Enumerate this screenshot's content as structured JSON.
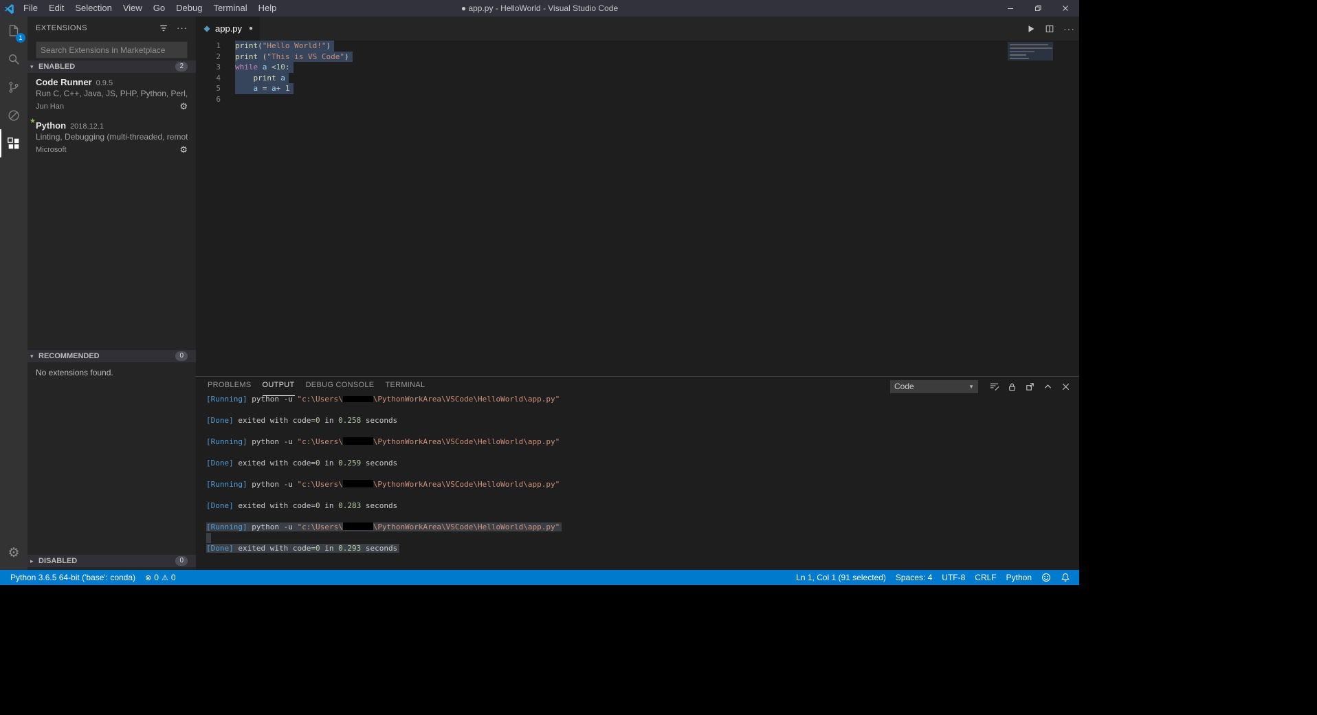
{
  "window": {
    "title": "● app.py - HelloWorld - Visual Studio Code",
    "menu_items": [
      "File",
      "Edit",
      "Selection",
      "View",
      "Go",
      "Debug",
      "Terminal",
      "Help"
    ]
  },
  "icons": {
    "gear": "⚙",
    "star": "★",
    "twisty_expanded": "▾",
    "twisty_collapsed": "▸",
    "ellipsis": "···",
    "dropdown_arrow": "▼",
    "error": "⊗",
    "warning": "⚠",
    "modified_dot": "●"
  },
  "activity_bar": {
    "explorer_badge": "1"
  },
  "sidebar": {
    "title": "EXTENSIONS",
    "search_placeholder": "Search Extensions in Marketplace",
    "sections": {
      "enabled": {
        "label": "ENABLED",
        "count": "2"
      },
      "recommended": {
        "label": "RECOMMENDED",
        "count": "0",
        "empty_message": "No extensions found."
      },
      "disabled": {
        "label": "DISABLED",
        "count": "0"
      }
    },
    "extensions": [
      {
        "name": "Code Runner",
        "version": "0.9.5",
        "description": "Run C, C++, Java, JS, PHP, Python, Perl, Ruby, ...",
        "author": "Jun Han",
        "starred": false
      },
      {
        "name": "Python",
        "version": "2018.12.1",
        "description": "Linting, Debugging (multi-threaded, remote), ...",
        "author": "Microsoft",
        "starred": true
      }
    ]
  },
  "editor": {
    "tab_label": "app.py",
    "lines": [
      {
        "num": "1",
        "selected": true,
        "tokens": [
          [
            "print",
            "func"
          ],
          [
            "(",
            "plain"
          ],
          [
            "\"Hello World!\"",
            "string"
          ],
          [
            ")",
            "plain"
          ]
        ]
      },
      {
        "num": "2",
        "selected": true,
        "tokens": [
          [
            "print",
            "func"
          ],
          [
            " (",
            "plain"
          ],
          [
            "\"This is VS Code\"",
            "string"
          ],
          [
            ")",
            "plain"
          ]
        ]
      },
      {
        "num": "3",
        "selected": true,
        "tokens": [
          [
            "while",
            "kw"
          ],
          [
            " ",
            "plain"
          ],
          [
            "a",
            "var"
          ],
          [
            " <",
            "plain"
          ],
          [
            "10",
            "number"
          ],
          [
            ":",
            "plain"
          ]
        ]
      },
      {
        "num": "4",
        "selected": true,
        "tokens": [
          [
            "    ",
            "plain"
          ],
          [
            "print",
            "func"
          ],
          [
            " ",
            "plain"
          ],
          [
            "a",
            "var"
          ]
        ]
      },
      {
        "num": "5",
        "selected": true,
        "tokens": [
          [
            "    ",
            "plain"
          ],
          [
            "a",
            "var"
          ],
          [
            " = ",
            "plain"
          ],
          [
            "a",
            "var"
          ],
          [
            "+ ",
            "plain"
          ],
          [
            "1",
            "number"
          ]
        ]
      },
      {
        "num": "6",
        "selected": false,
        "tokens": []
      }
    ]
  },
  "panel": {
    "tabs": [
      {
        "label": "PROBLEMS",
        "active": false
      },
      {
        "label": "OUTPUT",
        "active": true
      },
      {
        "label": "DEBUG CONSOLE",
        "active": false
      },
      {
        "label": "TERMINAL",
        "active": false
      }
    ],
    "channel": "Code",
    "output": [
      {
        "blank": true
      },
      {
        "selected": false,
        "tokens": [
          [
            "[Running] ",
            "tag"
          ],
          [
            "python -u ",
            "plain"
          ],
          [
            "\"c:\\Users\\",
            "string"
          ],
          [
            "",
            "redact"
          ],
          [
            "\\PythonWorkArea\\VSCode\\HelloWorld\\app.py\"",
            "string"
          ]
        ]
      },
      {
        "blank": true
      },
      {
        "selected": false,
        "tokens": [
          [
            "[Done] ",
            "tag"
          ],
          [
            "exited with code=",
            "plain"
          ],
          [
            "0",
            "number"
          ],
          [
            " in ",
            "plain"
          ],
          [
            "0.258",
            "number"
          ],
          [
            " seconds",
            "plain"
          ]
        ]
      },
      {
        "blank": true
      },
      {
        "selected": false,
        "tokens": [
          [
            "[Running] ",
            "tag"
          ],
          [
            "python -u ",
            "plain"
          ],
          [
            "\"c:\\Users\\",
            "string"
          ],
          [
            "",
            "redact"
          ],
          [
            "\\PythonWorkArea\\VSCode\\HelloWorld\\app.py\"",
            "string"
          ]
        ]
      },
      {
        "blank": true
      },
      {
        "selected": false,
        "tokens": [
          [
            "[Done] ",
            "tag"
          ],
          [
            "exited with code=",
            "plain"
          ],
          [
            "0",
            "number"
          ],
          [
            " in ",
            "plain"
          ],
          [
            "0.259",
            "number"
          ],
          [
            " seconds",
            "plain"
          ]
        ]
      },
      {
        "blank": true
      },
      {
        "selected": false,
        "tokens": [
          [
            "[Running] ",
            "tag"
          ],
          [
            "python -u ",
            "plain"
          ],
          [
            "\"c:\\Users\\",
            "string"
          ],
          [
            "",
            "redact"
          ],
          [
            "\\PythonWorkArea\\VSCode\\HelloWorld\\app.py\"",
            "string"
          ]
        ]
      },
      {
        "blank": true
      },
      {
        "selected": false,
        "tokens": [
          [
            "[Done] ",
            "tag"
          ],
          [
            "exited with code=",
            "plain"
          ],
          [
            "0",
            "number"
          ],
          [
            " in ",
            "plain"
          ],
          [
            "0.283",
            "number"
          ],
          [
            " seconds",
            "plain"
          ]
        ]
      },
      {
        "blank": true
      },
      {
        "selected": true,
        "tokens": [
          [
            "[Running] ",
            "tag"
          ],
          [
            "python -u ",
            "plain"
          ],
          [
            "\"c:\\Users\\",
            "string"
          ],
          [
            "",
            "redact"
          ],
          [
            "\\PythonWorkArea\\VSCode\\HelloWorld\\app.py\"",
            "string"
          ]
        ]
      },
      {
        "blank": true,
        "strip": true
      },
      {
        "selected": true,
        "tokens": [
          [
            "[Done] ",
            "tag"
          ],
          [
            "exited with code=",
            "plain"
          ],
          [
            "0",
            "number"
          ],
          [
            " in ",
            "plain"
          ],
          [
            "0.293",
            "number"
          ],
          [
            " seconds",
            "plain"
          ]
        ]
      },
      {
        "blank": true
      }
    ]
  },
  "status_bar": {
    "python_version": "Python 3.6.5 64-bit ('base': conda)",
    "errors": "0",
    "warnings": "0",
    "right_items": [
      {
        "name": "cursor-position",
        "label": "Ln 1, Col 1 (91 selected)"
      },
      {
        "name": "indentation",
        "label": "Spaces: 4"
      },
      {
        "name": "encoding",
        "label": "UTF-8"
      },
      {
        "name": "eol",
        "label": "CRLF"
      },
      {
        "name": "language-mode",
        "label": "Python"
      }
    ]
  },
  "colors": {
    "status_bar": "#007acc",
    "badge": "#007acc",
    "editor_selection": "#37455c",
    "output_selection": "#3a3f45",
    "tag_blue": "#569cd6",
    "string_orange": "#ce9178",
    "number_green": "#b5cea8",
    "keyword_magenta": "#c586c0",
    "function_yellow": "#dcdcaa",
    "variable_blue": "#9cdcfe"
  }
}
